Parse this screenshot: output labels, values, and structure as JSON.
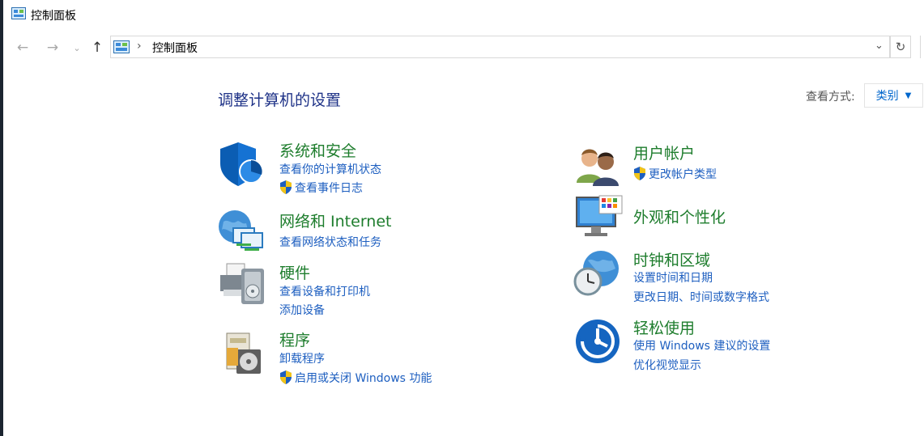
{
  "window": {
    "title": "控制面板"
  },
  "nav": {
    "back_icon": "back-arrow-icon",
    "forward_icon": "forward-arrow-icon",
    "recent_icon": "chevron-down-icon",
    "up_icon": "up-arrow-icon",
    "breadcrumb_sep": "›",
    "address": "控制面板",
    "dropdown_glyph": "⌄",
    "refresh_glyph": "↻"
  },
  "header": {
    "heading": "调整计算机的设置",
    "view_label": "查看方式:",
    "view_value": "类别",
    "view_caret": "▼"
  },
  "categories": {
    "system": {
      "title": "系统和安全",
      "links": [
        "查看你的计算机状态",
        "查看事件日志"
      ]
    },
    "network": {
      "title": "网络和 Internet",
      "links": [
        "查看网络状态和任务"
      ]
    },
    "hardware": {
      "title": "硬件",
      "links": [
        "查看设备和打印机",
        "添加设备"
      ]
    },
    "programs": {
      "title": "程序",
      "links": [
        "卸载程序",
        "启用或关闭 Windows 功能"
      ]
    },
    "users": {
      "title": "用户帐户",
      "links": [
        "更改帐户类型"
      ]
    },
    "appearance": {
      "title": "外观和个性化",
      "links": []
    },
    "clock": {
      "title": "时钟和区域",
      "links": [
        "设置时间和日期",
        "更改日期、时间或数字格式"
      ]
    },
    "ease": {
      "title": "轻松使用",
      "links": [
        "使用 Windows 建议的设置",
        "优化视觉显示"
      ]
    }
  },
  "colors": {
    "category_title": "#1e7d2d",
    "link": "#1e5fc0",
    "heading": "#1e3287"
  }
}
